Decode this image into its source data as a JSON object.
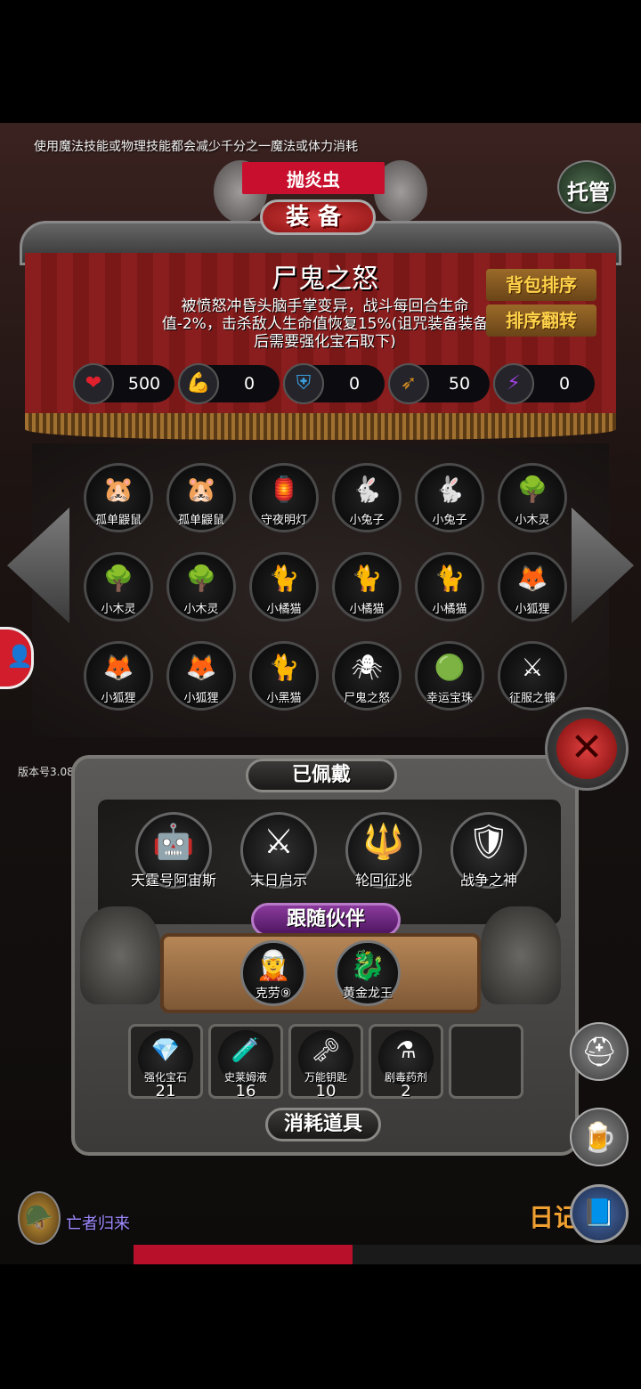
{
  "tip": "使用魔法技能或物理技能都会减少千分之一魔法或体力消耗",
  "top_banner": "抛炎虫",
  "equip_title": "装备",
  "tuoguan": "托管",
  "item": {
    "name": "尸鬼之怒",
    "description": "被愤怒冲昏头脑手掌变异，战斗每回合生命值-2%，击杀敌人生命值恢复15%(诅咒装备装备后需要强化宝石取下)"
  },
  "side_buttons": [
    "背包排序",
    "排序翻转"
  ],
  "stats": [
    {
      "icon": "heart-icon",
      "glyph": "❤",
      "color": "#e0202c",
      "value": "500"
    },
    {
      "icon": "strength-icon",
      "glyph": "💪",
      "color": "#e0b020",
      "value": "0"
    },
    {
      "icon": "armor-icon",
      "glyph": "⛨",
      "color": "#3aa0e0",
      "value": "0"
    },
    {
      "icon": "attack-speed-icon",
      "glyph": "➶",
      "color": "#d08a20",
      "value": "50"
    },
    {
      "icon": "magic-icon",
      "glyph": "⚡",
      "color": "#a040e0",
      "value": "0"
    }
  ],
  "inventory": [
    {
      "label": "孤单鼹鼠",
      "glyph": "🐹"
    },
    {
      "label": "孤单鼹鼠",
      "glyph": "🐹"
    },
    {
      "label": "守夜明灯",
      "glyph": "🏮"
    },
    {
      "label": "小兔子",
      "glyph": "🐇"
    },
    {
      "label": "小兔子",
      "glyph": "🐇"
    },
    {
      "label": "小木灵",
      "glyph": "🌳"
    },
    {
      "label": "小木灵",
      "glyph": "🌳"
    },
    {
      "label": "小木灵",
      "glyph": "🌳"
    },
    {
      "label": "小橘猫",
      "glyph": "🐈"
    },
    {
      "label": "小橘猫",
      "glyph": "🐈"
    },
    {
      "label": "小橘猫",
      "glyph": "🐈"
    },
    {
      "label": "小狐狸",
      "glyph": "🦊"
    },
    {
      "label": "小狐狸",
      "glyph": "🦊"
    },
    {
      "label": "小狐狸",
      "glyph": "🦊"
    },
    {
      "label": "小黑猫",
      "glyph": "🐈"
    },
    {
      "label": "尸鬼之怒",
      "glyph": "🕷"
    },
    {
      "label": "幸运宝珠",
      "glyph": "🟢"
    },
    {
      "label": "征服之镰",
      "glyph": "⚔"
    }
  ],
  "version": "版本号3.08",
  "equipped_title": "已佩戴",
  "equipped": [
    {
      "label": "天霆号阿宙斯",
      "glyph": "🤖"
    },
    {
      "label": "末日启示",
      "glyph": "⚔"
    },
    {
      "label": "轮回征兆",
      "glyph": "🔱"
    },
    {
      "label": "战争之神",
      "glyph": "🛡"
    }
  ],
  "companions_title": "跟随伙伴",
  "companions": [
    {
      "label": "克劳⑨",
      "glyph": "🧝"
    },
    {
      "label": "黄金龙王",
      "glyph": "🐉"
    }
  ],
  "consumables": [
    {
      "label": "强化宝石",
      "count": "21",
      "glyph": "💎"
    },
    {
      "label": "史莱姆液",
      "count": "16",
      "glyph": "🧪"
    },
    {
      "label": "万能钥匙",
      "count": "10",
      "glyph": "🗝"
    },
    {
      "label": "剧毒药剂",
      "count": "2",
      "glyph": "⚗"
    }
  ],
  "consumables_title": "消耗道具",
  "hero_label": "亡者归来",
  "diary": "日记"
}
